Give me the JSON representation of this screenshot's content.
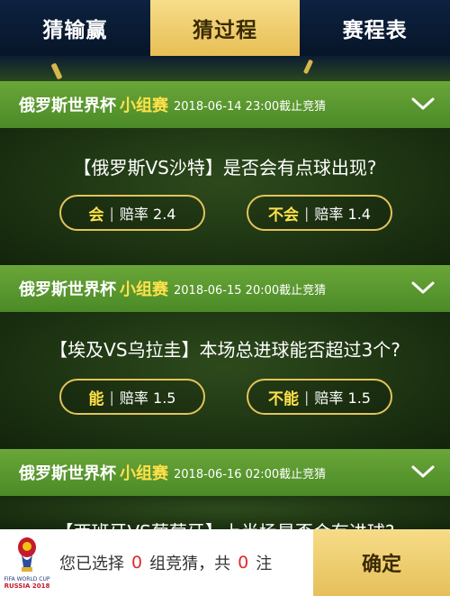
{
  "tabs": [
    {
      "label": "猜输赢",
      "active": false
    },
    {
      "label": "猜过程",
      "active": true
    },
    {
      "label": "赛程表",
      "active": false
    }
  ],
  "matches": [
    {
      "league": "俄罗斯世界杯",
      "stage": "小组赛",
      "deadline": "2018-06-14 23:00截止竞猜",
      "question": "【俄罗斯VS沙特】是否会有点球出现?",
      "options": [
        {
          "pick": "会",
          "odds_label": "赔率 2.4"
        },
        {
          "pick": "不会",
          "odds_label": "赔率 1.4"
        }
      ]
    },
    {
      "league": "俄罗斯世界杯",
      "stage": "小组赛",
      "deadline": "2018-06-15 20:00截止竞猜",
      "question": "【埃及VS乌拉圭】本场总进球能否超过3个?",
      "options": [
        {
          "pick": "能",
          "odds_label": "赔率 1.5"
        },
        {
          "pick": "不能",
          "odds_label": "赔率 1.5"
        }
      ]
    },
    {
      "league": "俄罗斯世界杯",
      "stage": "小组赛",
      "deadline": "2018-06-16 02:00截止竞猜",
      "question": "【西班牙VS葡萄牙】上半场是否会有进球?"
    }
  ],
  "bottom_bar": {
    "logo_text": "FIFA WORLD CUP RUSSIA 2018",
    "summary_prefix": "您已选择",
    "selected_groups": "0",
    "summary_mid": "组竞猜，共",
    "total_bets": "0",
    "summary_suffix": "注",
    "confirm_label": "确定"
  },
  "colors": {
    "header_green": "#5c9a30",
    "stage_yellow": "#ffe14a",
    "option_border": "#e3c35a",
    "tab_active": "#f0d070",
    "count_red": "#e02a2a"
  }
}
